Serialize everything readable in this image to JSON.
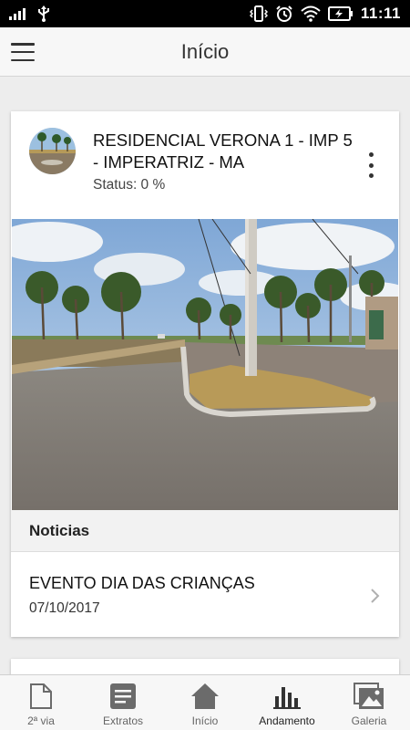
{
  "status_bar": {
    "time": "11:11",
    "icons": [
      "signal-icon",
      "usb-icon",
      "vibrate-icon",
      "alarm-icon",
      "wifi-icon",
      "battery-charging-icon"
    ]
  },
  "app_bar": {
    "title": "Início",
    "menu_icon": "hamburger-menu-icon"
  },
  "project_card": {
    "title": "RESIDENCIAL VERONA 1 - IMP 5 - IMPERATRIZ - MA",
    "status": "Status: 0 %",
    "more_icon": "more-vertical-icon",
    "photo": "street-with-palm-trees-photo"
  },
  "news": {
    "header": "Noticias",
    "items": [
      {
        "title": "EVENTO DIA DAS CRIANÇAS",
        "date": "07/10/2017"
      }
    ]
  },
  "bottom_nav": {
    "items": [
      {
        "label": "2ª via",
        "icon": "document-icon"
      },
      {
        "label": "Extratos",
        "icon": "statement-icon"
      },
      {
        "label": "Início",
        "icon": "home-icon"
      },
      {
        "label": "Andamento",
        "icon": "bar-chart-icon",
        "active": true
      },
      {
        "label": "Galeria",
        "icon": "gallery-icon"
      }
    ]
  },
  "colors": {
    "status_bar": "#000000",
    "app_bar": "#f7f7f7",
    "background": "#ededed",
    "icon_gray": "#6b6b6b"
  }
}
